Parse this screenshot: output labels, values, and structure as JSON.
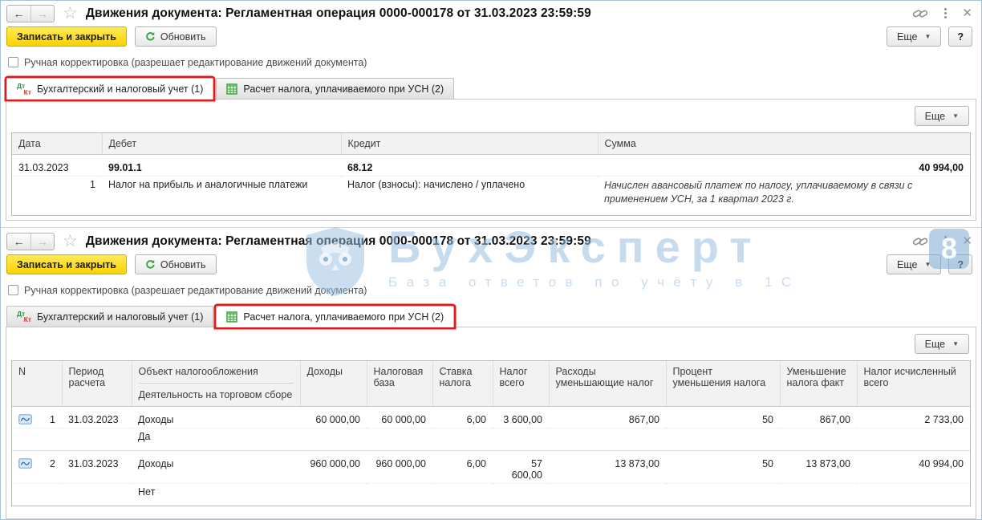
{
  "common": {
    "title": "Движения документа: Регламентная операция 0000-000178 от 31.03.2023 23:59:59",
    "save_close": "Записать и закрыть",
    "refresh": "Обновить",
    "more": "Еще",
    "help": "?",
    "manual_adjust": "Ручная корректировка (разрешает редактирование движений документа)",
    "tab_accounting": "Бухгалтерский и налоговый учет (1)",
    "tab_usn": "Расчет налога, уплачиваемого при УСН (2)",
    "accent_yellow": "#fbd301",
    "highlight_red": "#e01a1a"
  },
  "icons": {
    "dt": "Дт",
    "kt": "Кт"
  },
  "accounting_table": {
    "headers": {
      "date": "Дата",
      "debit": "Дебет",
      "credit": "Кредит",
      "amount": "Сумма"
    },
    "row": {
      "date": "31.03.2023",
      "line_no": "1",
      "debit_account": "99.01.1",
      "debit_desc": "Налог на прибыль и аналогичные платежи",
      "credit_account": "68.12",
      "credit_desc": "Налог (взносы): начислено / уплачено",
      "amount": "40 994,00",
      "comment": "Начислен авансовый платеж по налогу, уплачиваемому в связи с применением УСН, за 1 квартал 2023 г."
    }
  },
  "usn_table": {
    "headers": {
      "n": "N",
      "period": "Период расчета",
      "object": "Объект налогообложения",
      "trade_activity": "Деятельность на торговом сборе",
      "income": "Доходы",
      "tax_base": "Налоговая база",
      "rate": "Ставка налога",
      "tax_total": "Налог всего",
      "expenses": "Расходы уменьшающие налог",
      "percent": "Процент уменьшения налога",
      "reduction_fact": "Уменьшение налога факт",
      "tax_calculated": "Налог исчисленный всего"
    },
    "rows": [
      {
        "n": "1",
        "period": "31.03.2023",
        "object": "Доходы",
        "trade": "Да",
        "income": "60 000,00",
        "base": "60 000,00",
        "rate": "6,00",
        "tax_total": "3 600,00",
        "expenses": "867,00",
        "percent": "50",
        "reduction": "867,00",
        "tax_calc": "2 733,00"
      },
      {
        "n": "2",
        "period": "31.03.2023",
        "object": "Доходы",
        "trade": "Нет",
        "income": "960 000,00",
        "base": "960 000,00",
        "rate": "6,00",
        "tax_total": "57 600,00",
        "expenses": "13 873,00",
        "percent": "50",
        "reduction": "13 873,00",
        "tax_calc": "40 994,00"
      }
    ]
  },
  "watermark": {
    "brand": "БухЭксперт",
    "badge": "8",
    "tagline": "База ответов по учёту в 1С"
  }
}
